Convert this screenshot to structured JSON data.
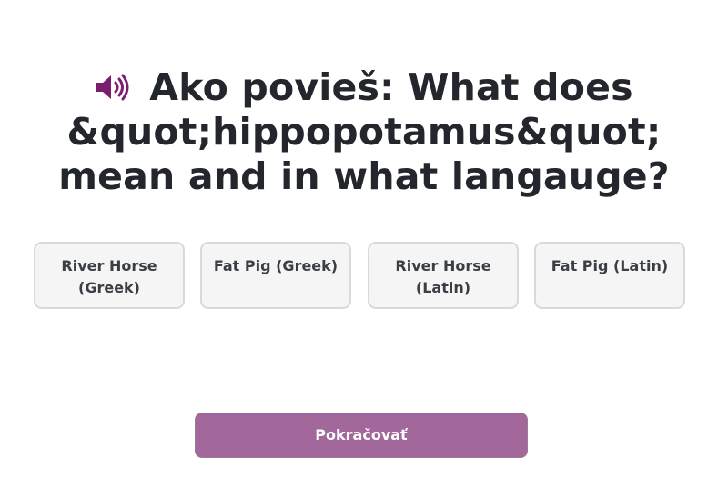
{
  "question": {
    "prefix": "Ako povieš: ",
    "text": "What does &quot;hippopotamus&quot; mean and in what langauge?",
    "speaker_icon": "speaker-icon",
    "accent_color": "#7a1f6e"
  },
  "answers": [
    {
      "label": "River Horse (Greek)"
    },
    {
      "label": "Fat Pig (Greek)"
    },
    {
      "label": "River Horse (Latin)"
    },
    {
      "label": "Fat Pig (Latin)"
    }
  ],
  "continue_button": {
    "label": "Pokračovať",
    "color": "#a3689b"
  }
}
